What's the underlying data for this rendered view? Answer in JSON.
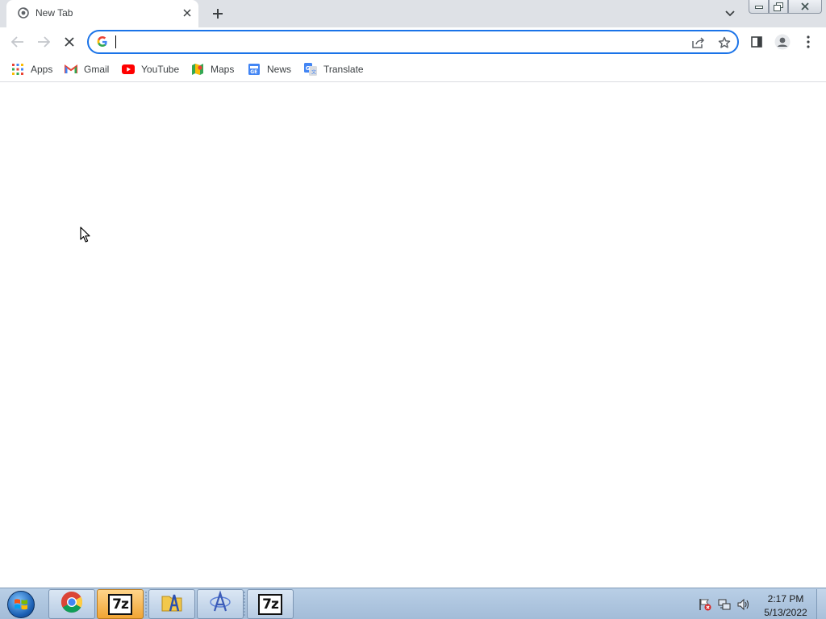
{
  "tab": {
    "title": "New Tab"
  },
  "omnibox": {
    "value": "",
    "placeholder": ""
  },
  "bookmarks": [
    {
      "label": "Apps",
      "icon": "apps-grid-icon"
    },
    {
      "label": "Gmail",
      "icon": "gmail-icon"
    },
    {
      "label": "YouTube",
      "icon": "youtube-icon"
    },
    {
      "label": "Maps",
      "icon": "maps-icon"
    },
    {
      "label": "News",
      "icon": "news-icon"
    },
    {
      "label": "Translate",
      "icon": "translate-icon"
    }
  ],
  "taskbar": {
    "apps": [
      {
        "name": "chrome",
        "icon": "chrome-icon",
        "active": false
      },
      {
        "name": "7-zip",
        "icon": "7zip-icon",
        "active": true,
        "label": "7z"
      },
      {
        "name": "folder",
        "icon": "folder-app-icon",
        "active": false
      },
      {
        "name": "app",
        "icon": "compass-app-icon",
        "active": false
      },
      {
        "name": "7-zip",
        "icon": "7zip-icon",
        "active": false,
        "label": "7z"
      }
    ],
    "clock": {
      "time": "2:17 PM",
      "date": "5/13/2022"
    }
  },
  "colors": {
    "accent": "#1a73e8",
    "tabstrip": "#dee1e6",
    "taskbar": "#b9cfe6"
  }
}
